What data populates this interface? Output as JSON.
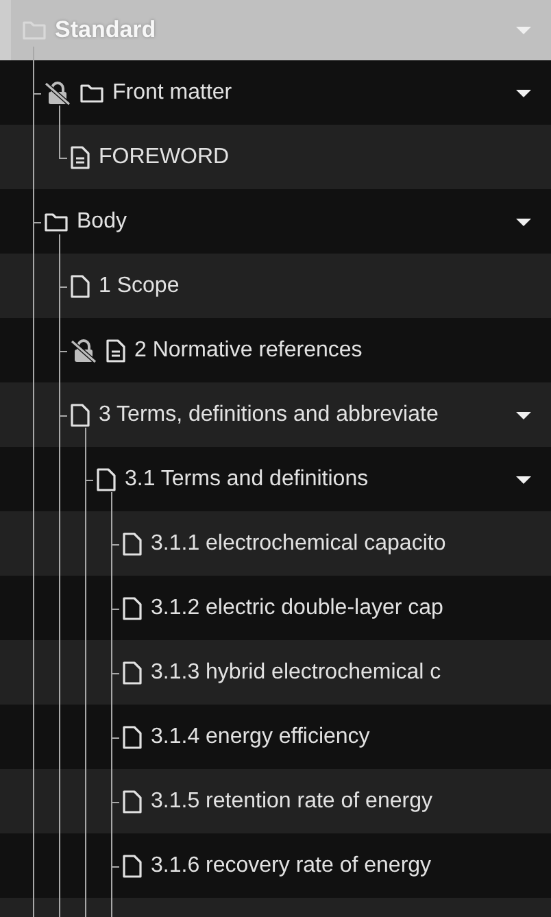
{
  "root": {
    "label": "Standard",
    "kind": "folder",
    "expanded": true,
    "children": [
      {
        "label": "Front matter",
        "kind": "folder",
        "locked": true,
        "expanded": true,
        "children": [
          {
            "label": "FOREWORD",
            "kind": "text-file",
            "locked": false
          }
        ]
      },
      {
        "label": "Body",
        "kind": "folder",
        "locked": false,
        "expanded": true,
        "children": [
          {
            "label": "1 Scope",
            "kind": "file",
            "locked": false
          },
          {
            "label": "2 Normative references",
            "kind": "text-file",
            "locked": true
          },
          {
            "label": "3 Terms, definitions and abbreviate",
            "kind": "file",
            "locked": false,
            "expanded": true,
            "children": [
              {
                "label": "3.1 Terms and definitions",
                "kind": "file",
                "locked": false,
                "expanded": true,
                "children": [
                  {
                    "label": "3.1.1 electrochemical capacito",
                    "kind": "file",
                    "locked": false
                  },
                  {
                    "label": "3.1.2 electric double-layer cap",
                    "kind": "file",
                    "locked": false
                  },
                  {
                    "label": "3.1.3 hybrid electrochemical c",
                    "kind": "file",
                    "locked": false
                  },
                  {
                    "label": "3.1.4 energy efficiency",
                    "kind": "file",
                    "locked": false
                  },
                  {
                    "label": "3.1.5 retention rate of energy",
                    "kind": "file",
                    "locked": false
                  },
                  {
                    "label": "3.1.6 recovery rate of energy",
                    "kind": "file",
                    "locked": false
                  }
                ]
              }
            ]
          }
        ]
      }
    ]
  }
}
